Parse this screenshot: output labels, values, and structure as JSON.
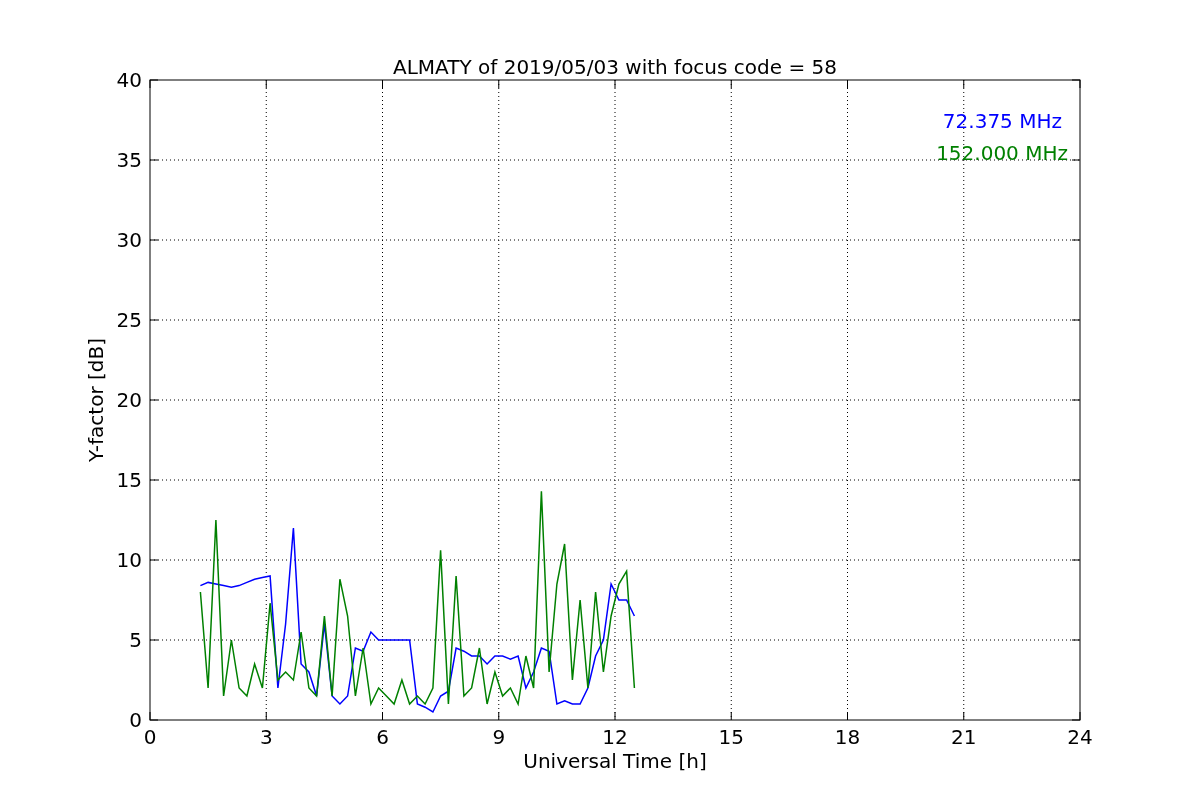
{
  "chart_data": {
    "type": "line",
    "title": "ALMATY of 2019/05/03 with focus code = 58",
    "xlabel": "Universal Time [h]",
    "ylabel": "Y-factor [dB]",
    "x": [
      1.3,
      1.5,
      1.7,
      1.9,
      2.1,
      2.3,
      2.5,
      2.7,
      2.9,
      3.1,
      3.3,
      3.5,
      3.7,
      3.9,
      4.1,
      4.3,
      4.5,
      4.7,
      4.9,
      5.1,
      5.3,
      5.5,
      5.7,
      5.9,
      6.1,
      6.3,
      6.5,
      6.7,
      6.9,
      7.1,
      7.3,
      7.5,
      7.7,
      7.9,
      8.1,
      8.3,
      8.5,
      8.7,
      8.9,
      9.1,
      9.3,
      9.5,
      9.7,
      9.9,
      10.1,
      10.3,
      10.5,
      10.7,
      10.9,
      11.1,
      11.3,
      11.5,
      11.7,
      11.9,
      12.1,
      12.3,
      12.5
    ],
    "series": [
      {
        "name": "72.375 MHz",
        "color": "#0000ff",
        "values": [
          8.4,
          8.6,
          8.5,
          8.4,
          8.3,
          8.4,
          8.6,
          8.8,
          8.9,
          9.0,
          2.0,
          6.0,
          12.0,
          3.5,
          3.0,
          1.5,
          6.0,
          1.5,
          1.0,
          1.5,
          4.5,
          4.3,
          5.5,
          5.0,
          5.0,
          5.0,
          5.0,
          5.0,
          1.0,
          0.8,
          0.5,
          1.5,
          1.8,
          4.5,
          4.3,
          4.0,
          4.0,
          3.5,
          4.0,
          4.0,
          3.8,
          4.0,
          2.0,
          3.0,
          4.5,
          4.3,
          1.0,
          1.2,
          1.0,
          1.0,
          2.0,
          4.0,
          5.0,
          8.5,
          7.5,
          7.5,
          6.5
        ]
      },
      {
        "name": "152.000 MHz",
        "color": "#008000",
        "values": [
          8.0,
          2.0,
          12.5,
          1.5,
          5.0,
          2.0,
          1.5,
          3.5,
          2.0,
          7.3,
          2.5,
          3.0,
          2.5,
          5.5,
          2.0,
          1.5,
          6.5,
          1.5,
          8.8,
          6.5,
          1.5,
          4.5,
          1.0,
          2.0,
          1.5,
          1.0,
          2.5,
          1.0,
          1.5,
          1.0,
          2.0,
          10.6,
          1.0,
          9.0,
          1.5,
          2.0,
          4.5,
          1.0,
          3.0,
          1.5,
          2.0,
          1.0,
          4.0,
          2.0,
          14.3,
          3.0,
          8.5,
          11.0,
          2.5,
          7.5,
          2.0,
          8.0,
          3.0,
          6.5,
          8.5,
          9.3,
          2.0
        ]
      }
    ],
    "grid": true,
    "xlim": [
      0,
      24
    ],
    "ylim": [
      0,
      40
    ],
    "xticks": [
      0,
      3,
      6,
      9,
      12,
      15,
      18,
      21,
      24
    ],
    "yticks": [
      0,
      5,
      10,
      15,
      20,
      25,
      30,
      35,
      40
    ]
  }
}
